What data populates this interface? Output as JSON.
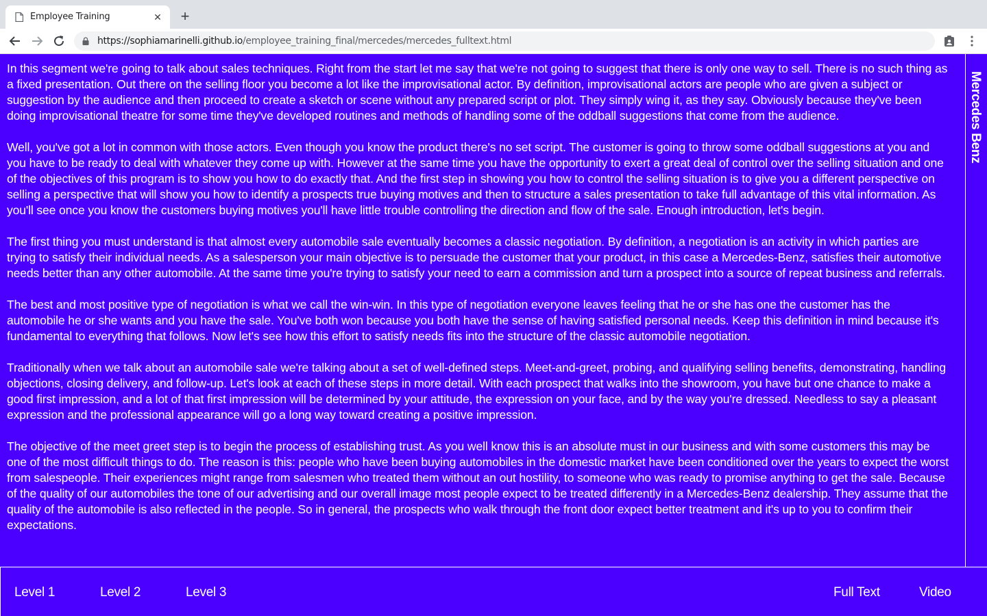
{
  "browser": {
    "tab_title": "Employee Training",
    "url_host": "https://sophiamarinelli.github.io",
    "url_path": "/employee_training_final/mercedes/mercedes_fulltext.html"
  },
  "page": {
    "side_label": "Mercedes Benz",
    "paragraphs": [
      "In this segment we're going to talk about sales techniques. Right from the start let me say that we're not going to suggest that there is only one way to sell. There is no such thing as a fixed presentation. Out there on the selling floor you become a lot like the improvisational actor. By definition, improvisational actors are people who are given a subject or suggestion by the audience and then proceed to create a sketch or scene without any prepared script or plot. They simply wing it, as they say. Obviously because they've been doing improvisational theatre for some time they've developed routines and methods of handling some of the oddball suggestions that come from the audience.",
      "Well, you've got a lot in common with those actors. Even though you know the product there's no set script. The customer is going to throw some oddball suggestions at you and you have to be ready to deal with whatever they come up with. However at the same time you have the opportunity to exert a great deal of control over the selling situation and one of the objectives of this program is to show you how to do exactly that. And the first step in showing you how to control the selling situation is to give you a different perspective on selling a perspective that will show you how to identify a prospects true buying motives and then to structure a sales presentation to take full advantage of this vital information. As you'll see once you know the customers buying motives you'll have little trouble controlling the direction and flow of the sale. Enough introduction, let's begin.",
      "The first thing you must understand is that almost every automobile sale eventually becomes a classic negotiation. By definition, a negotiation is an activity in which parties are trying to satisfy their individual needs. As a salesperson your main objective is to persuade the customer that your product, in this case a Mercedes-Benz, satisfies their automotive needs better than any other automobile. At the same time you're trying to satisfy your need to earn a commission and turn a prospect into a source of repeat business and referrals.",
      "The best and most positive type of negotiation is what we call the win-win. In this type of negotiation everyone leaves feeling that he or she has one the customer has the automobile he or she wants and you have the sale. You've both won because you both have the sense of having satisfied personal needs. Keep this definition in mind because it's fundamental to everything that follows. Now let's see how this effort to satisfy needs fits into the structure of the classic automobile negotiation.",
      "Traditionally when we talk about an automobile sale we're talking about a set of well-defined steps. Meet-and-greet, probing, and qualifying selling benefits, demonstrating, handling objections, closing delivery, and follow-up. Let's look at each of these steps in more detail. With each prospect that walks into the showroom, you have but one chance to make a good first impression, and a lot of that first impression will be determined by your attitude, the expression on your face, and by the way you're dressed. Needless to say a pleasant expression and the professional appearance will go a long way toward creating a positive impression.",
      "The objective of the meet greet step is to begin the process of establishing trust. As you well know this is an absolute must in our business and with some customers this may be one of the most difficult things to do. The reason is this: people who have been buying automobiles in the domestic market have been conditioned over the years to expect the worst from salespeople. Their experiences might range from salesmen who treated them without an out hostility, to someone who was ready to promise anything to get the sale. Because of the quality of our automobiles the tone of our advertising and our overall image most people expect to be treated differently in a Mercedes-Benz dealership. They assume that the quality of the automobile is also reflected in the people. So in general, the prospects who walk through the front door expect better treatment and it's up to you to confirm their expectations."
    ]
  },
  "footer": {
    "level1": "Level 1",
    "level2": "Level 2",
    "level3": "Level 3",
    "full_text": "Full Text",
    "video": "Video"
  },
  "colors": {
    "page_background": "#4b00ff",
    "text": "#ffffff"
  }
}
